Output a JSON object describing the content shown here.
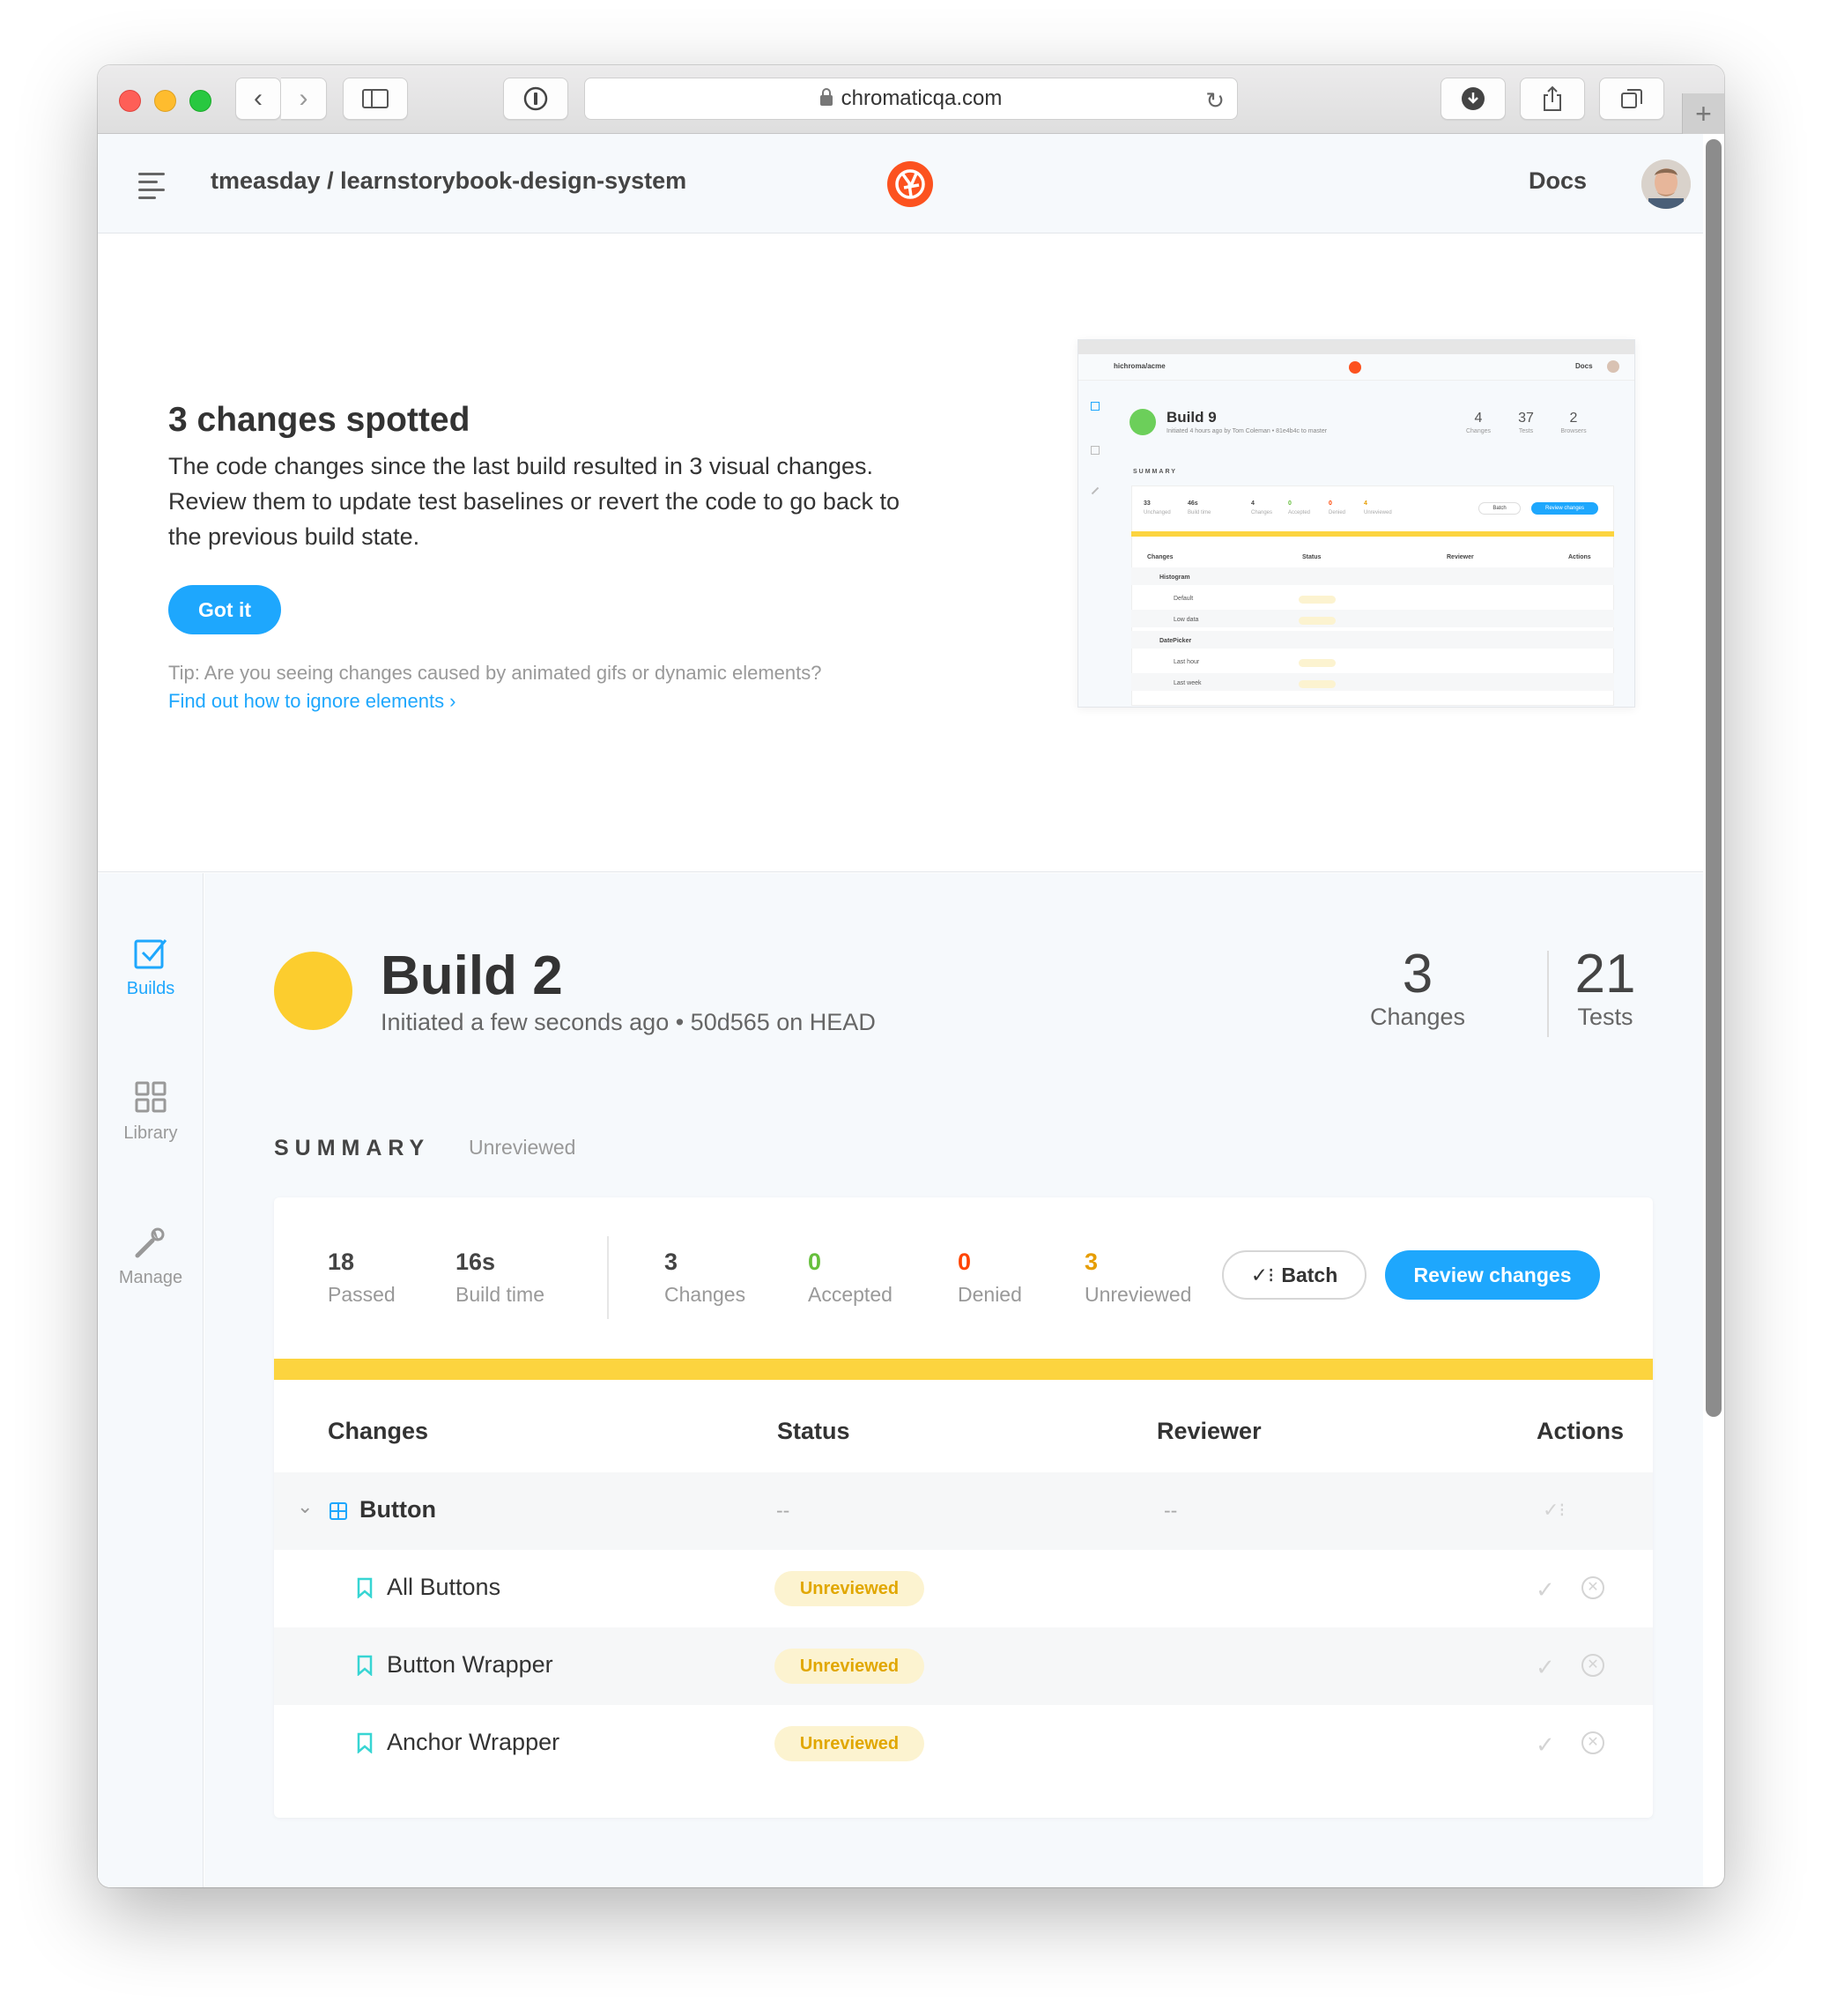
{
  "browser": {
    "url": "chromaticqa.com"
  },
  "header": {
    "repo": "tmeasday / learnstorybook-design-system",
    "docs": "Docs"
  },
  "onboarding": {
    "title": "3 changes spotted",
    "description": "The code changes since the last build resulted in 3 visual changes. Review them to update test baselines or revert the code to go back to the previous build state.",
    "button": "Got it",
    "tip": "Tip: Are you seeing changes caused by animated gifs or dynamic elements?",
    "link": "Find out how to ignore elements ›"
  },
  "thumbnail": {
    "repo": "hichroma/acme",
    "docs": "Docs",
    "build": "Build 9",
    "sub": "Initiated 4 hours ago by Tom Coleman • 81e4b4c to master",
    "stats": [
      {
        "n": "4",
        "l": "Changes"
      },
      {
        "n": "37",
        "l": "Tests"
      },
      {
        "n": "2",
        "l": "Browsers"
      }
    ],
    "summary": "SUMMARY",
    "mini": [
      {
        "n": "33",
        "l": "Unchanged"
      },
      {
        "n": "46s",
        "l": "Build time"
      },
      {
        "n": "4",
        "l": "Changes"
      },
      {
        "n": "0",
        "l": "Accepted"
      },
      {
        "n": "0",
        "l": "Denied"
      },
      {
        "n": "4",
        "l": "Unreviewed"
      }
    ],
    "batch": "Batch",
    "review": "Review changes",
    "columns": [
      "Changes",
      "Status",
      "Reviewer",
      "Actions"
    ],
    "rows": [
      "Histogram",
      "Default",
      "Low data",
      "DatePicker",
      "Last hour",
      "Last week"
    ]
  },
  "sidebar": {
    "items": [
      {
        "label": "Builds"
      },
      {
        "label": "Library"
      },
      {
        "label": "Manage"
      }
    ]
  },
  "build": {
    "title": "Build 2",
    "subtitle": "Initiated a few seconds ago • 50d565 on HEAD",
    "status_color": "#fccd2e",
    "stats": [
      {
        "value": "3",
        "label": "Changes"
      },
      {
        "value": "21",
        "label": "Tests"
      }
    ]
  },
  "summary": {
    "heading": "SUMMARY",
    "status": "Unreviewed",
    "metrics": [
      {
        "value": "18",
        "label": "Passed"
      },
      {
        "value": "16s",
        "label": "Build time"
      },
      {
        "value": "3",
        "label": "Changes"
      },
      {
        "value": "0",
        "label": "Accepted",
        "color": "#66bf3c"
      },
      {
        "value": "0",
        "label": "Denied",
        "color": "#ff4400"
      },
      {
        "value": "3",
        "label": "Unreviewed",
        "color": "#e69d00"
      }
    ],
    "batch": "Batch",
    "review": "Review changes"
  },
  "table": {
    "columns": [
      "Changes",
      "Status",
      "Reviewer",
      "Actions"
    ],
    "group": {
      "name": "Button",
      "status": "--",
      "reviewer": "--"
    },
    "rows": [
      {
        "name": "All Buttons",
        "status": "Unreviewed"
      },
      {
        "name": "Button Wrapper",
        "status": "Unreviewed"
      },
      {
        "name": "Anchor Wrapper",
        "status": "Unreviewed"
      }
    ]
  }
}
